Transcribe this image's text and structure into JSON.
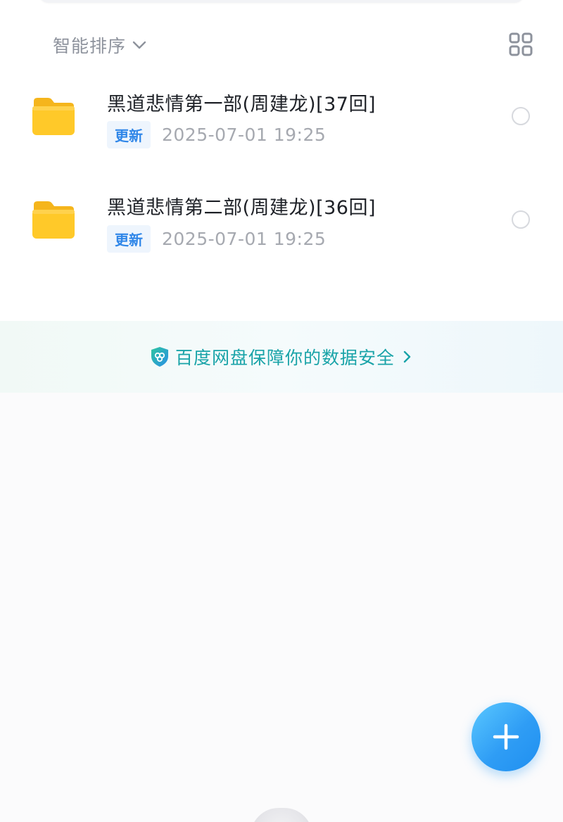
{
  "sort": {
    "label": "智能排序",
    "icon": "chevron-down-icon"
  },
  "view_toggle": {
    "icon": "grid-view-icon"
  },
  "files": [
    {
      "name": "黑道悲情第一部(周建龙)[37回]",
      "badge": "更新",
      "date": "2025-07-01",
      "time": "19:25",
      "icon": "folder-icon"
    },
    {
      "name": "黑道悲情第二部(周建龙)[36回]",
      "badge": "更新",
      "date": "2025-07-01",
      "time": "19:25",
      "icon": "folder-icon"
    }
  ],
  "banner": {
    "text": "百度网盘保障你的数据安全",
    "icon": "shield-icon"
  },
  "fab": {
    "icon": "plus-icon"
  },
  "colors": {
    "accent": "#2f9df5",
    "banner_text": "#19a3a8",
    "folder": "#ffc929"
  }
}
